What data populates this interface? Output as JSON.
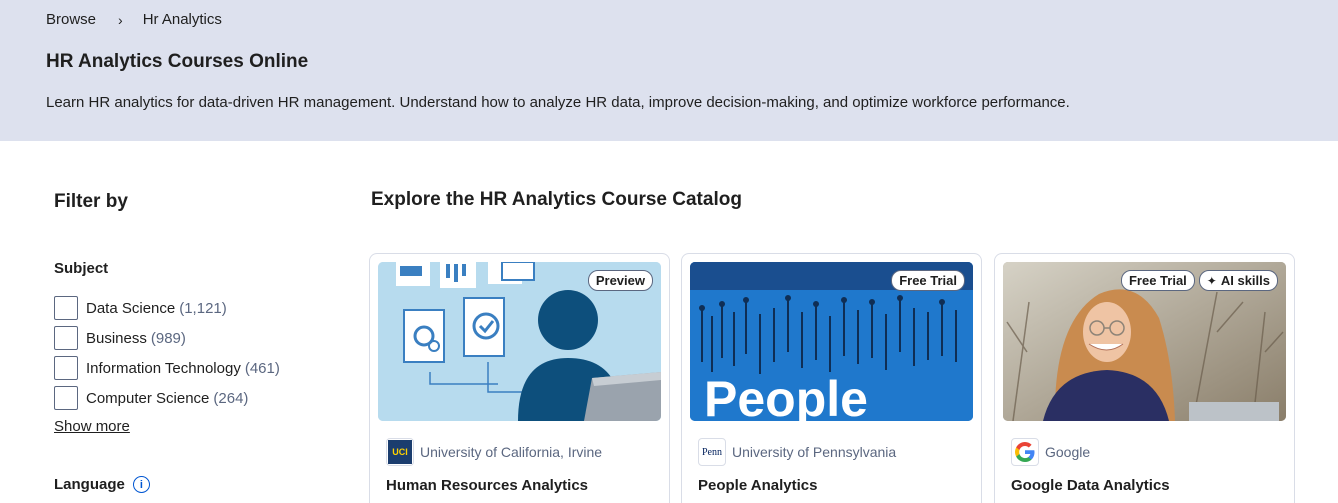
{
  "breadcrumb": {
    "items": [
      "Browse",
      "Hr Analytics"
    ],
    "separator": "›"
  },
  "hero": {
    "title": "HR Analytics Courses Online",
    "description": "Learn HR analytics for data-driven HR management. Understand how to analyze HR data, improve decision-making, and optimize workforce performance."
  },
  "filters": {
    "title": "Filter by",
    "subject": {
      "title": "Subject",
      "options": [
        {
          "label": "Data Science",
          "count": "(1,121)"
        },
        {
          "label": "Business",
          "count": "(989)"
        },
        {
          "label": "Information Technology",
          "count": "(461)"
        },
        {
          "label": "Computer Science",
          "count": "(264)"
        }
      ],
      "show_more": "Show more"
    },
    "language": {
      "title": "Language",
      "info_icon": "i"
    }
  },
  "catalog": {
    "title": "Explore the HR Analytics Course Catalog",
    "cards": [
      {
        "badges": [
          "Preview"
        ],
        "partner_logo": "UCI",
        "partner": "University of California, Irvine",
        "title": "Human Resources Analytics",
        "image_icon": "person-at-computer-illustration"
      },
      {
        "badges": [
          "Free Trial"
        ],
        "partner_logo": "Penn",
        "partner": "University of Pennsylvania",
        "title": "People Analytics",
        "image_text": "People",
        "image_icon": "people-lettering-image"
      },
      {
        "badges": [
          "Free Trial",
          "AI skills"
        ],
        "partner_logo": "G",
        "partner": "Google",
        "title": "Google Data Analytics",
        "image_icon": "woman-portrait-photo"
      }
    ]
  },
  "colors": {
    "hero_bg": "#dde1ee",
    "brand_blue": "#0056d2",
    "uci_blue": "#1b3d6e",
    "uci_gold": "#ffd200"
  }
}
